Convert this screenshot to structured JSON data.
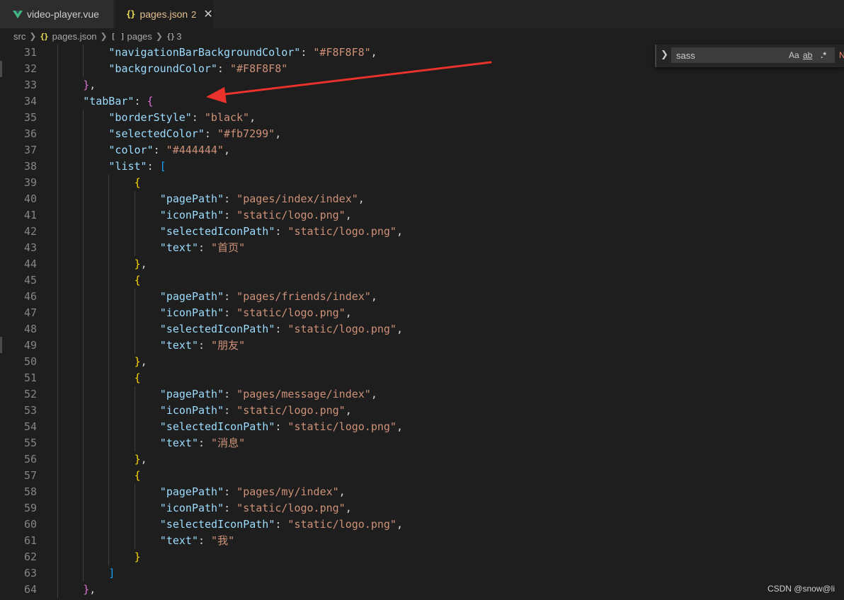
{
  "tabs": [
    {
      "label": "video-player.vue",
      "icon": "vue-icon",
      "active": false
    },
    {
      "label": "pages.json",
      "icon": "braces-icon",
      "badge": "2",
      "active": true
    }
  ],
  "breadcrumb": {
    "items": [
      "src",
      "pages.json",
      "pages",
      "3"
    ]
  },
  "find": {
    "value": "sass",
    "options": [
      "Aa",
      "ab",
      ".*"
    ],
    "result": "N"
  },
  "editor": {
    "lines": [
      {
        "n": "31",
        "indent": 2,
        "tokens": [
          {
            "t": "\"navigationBarBackgroundColor\"",
            "c": "k"
          },
          {
            "t": ": ",
            "c": "p"
          },
          {
            "t": "\"#F8F8F8\"",
            "c": "s"
          },
          {
            "t": ",",
            "c": "p"
          }
        ]
      },
      {
        "n": "32",
        "indent": 2,
        "tokens": [
          {
            "t": "\"backgroundColor\"",
            "c": "k"
          },
          {
            "t": ": ",
            "c": "p"
          },
          {
            "t": "\"#F8F8F8\"",
            "c": "s"
          }
        ]
      },
      {
        "n": "33",
        "indent": 1,
        "tokens": [
          {
            "t": "}",
            "c": "b2"
          },
          {
            "t": ",",
            "c": "p"
          }
        ]
      },
      {
        "n": "34",
        "indent": 1,
        "tokens": [
          {
            "t": "\"tabBar\"",
            "c": "k"
          },
          {
            "t": ": ",
            "c": "p"
          },
          {
            "t": "{",
            "c": "b2"
          }
        ]
      },
      {
        "n": "35",
        "indent": 2,
        "tokens": [
          {
            "t": "\"borderStyle\"",
            "c": "k"
          },
          {
            "t": ": ",
            "c": "p"
          },
          {
            "t": "\"black\"",
            "c": "s"
          },
          {
            "t": ",",
            "c": "p"
          }
        ]
      },
      {
        "n": "36",
        "indent": 2,
        "tokens": [
          {
            "t": "\"selectedColor\"",
            "c": "k"
          },
          {
            "t": ": ",
            "c": "p"
          },
          {
            "t": "\"#fb7299\"",
            "c": "s"
          },
          {
            "t": ",",
            "c": "p"
          }
        ]
      },
      {
        "n": "37",
        "indent": 2,
        "tokens": [
          {
            "t": "\"color\"",
            "c": "k"
          },
          {
            "t": ": ",
            "c": "p"
          },
          {
            "t": "\"#444444\"",
            "c": "s"
          },
          {
            "t": ",",
            "c": "p"
          }
        ]
      },
      {
        "n": "38",
        "indent": 2,
        "tokens": [
          {
            "t": "\"list\"",
            "c": "k"
          },
          {
            "t": ": ",
            "c": "p"
          },
          {
            "t": "[",
            "c": "b3"
          }
        ]
      },
      {
        "n": "39",
        "indent": 3,
        "tokens": [
          {
            "t": "{",
            "c": "b1"
          }
        ]
      },
      {
        "n": "40",
        "indent": 4,
        "tokens": [
          {
            "t": "\"pagePath\"",
            "c": "k"
          },
          {
            "t": ": ",
            "c": "p"
          },
          {
            "t": "\"pages/index/index\"",
            "c": "s"
          },
          {
            "t": ",",
            "c": "p"
          }
        ]
      },
      {
        "n": "41",
        "indent": 4,
        "tokens": [
          {
            "t": "\"iconPath\"",
            "c": "k"
          },
          {
            "t": ": ",
            "c": "p"
          },
          {
            "t": "\"static/logo.png\"",
            "c": "s"
          },
          {
            "t": ",",
            "c": "p"
          }
        ]
      },
      {
        "n": "42",
        "indent": 4,
        "tokens": [
          {
            "t": "\"selectedIconPath\"",
            "c": "k"
          },
          {
            "t": ": ",
            "c": "p"
          },
          {
            "t": "\"static/logo.png\"",
            "c": "s"
          },
          {
            "t": ",",
            "c": "p"
          }
        ]
      },
      {
        "n": "43",
        "indent": 4,
        "tokens": [
          {
            "t": "\"text\"",
            "c": "k"
          },
          {
            "t": ": ",
            "c": "p"
          },
          {
            "t": "\"首页\"",
            "c": "s"
          }
        ]
      },
      {
        "n": "44",
        "indent": 3,
        "tokens": [
          {
            "t": "}",
            "c": "b1"
          },
          {
            "t": ",",
            "c": "p"
          }
        ]
      },
      {
        "n": "45",
        "indent": 3,
        "tokens": [
          {
            "t": "{",
            "c": "b1"
          }
        ]
      },
      {
        "n": "46",
        "indent": 4,
        "tokens": [
          {
            "t": "\"pagePath\"",
            "c": "k"
          },
          {
            "t": ": ",
            "c": "p"
          },
          {
            "t": "\"pages/friends/index\"",
            "c": "s"
          },
          {
            "t": ",",
            "c": "p"
          }
        ]
      },
      {
        "n": "47",
        "indent": 4,
        "tokens": [
          {
            "t": "\"iconPath\"",
            "c": "k"
          },
          {
            "t": ": ",
            "c": "p"
          },
          {
            "t": "\"static/logo.png\"",
            "c": "s"
          },
          {
            "t": ",",
            "c": "p"
          }
        ]
      },
      {
        "n": "48",
        "indent": 4,
        "tokens": [
          {
            "t": "\"selectedIconPath\"",
            "c": "k"
          },
          {
            "t": ": ",
            "c": "p"
          },
          {
            "t": "\"static/logo.png\"",
            "c": "s"
          },
          {
            "t": ",",
            "c": "p"
          }
        ]
      },
      {
        "n": "49",
        "indent": 4,
        "tokens": [
          {
            "t": "\"text\"",
            "c": "k"
          },
          {
            "t": ": ",
            "c": "p"
          },
          {
            "t": "\"朋友\"",
            "c": "s"
          }
        ]
      },
      {
        "n": "50",
        "indent": 3,
        "tokens": [
          {
            "t": "}",
            "c": "b1"
          },
          {
            "t": ",",
            "c": "p"
          }
        ]
      },
      {
        "n": "51",
        "indent": 3,
        "tokens": [
          {
            "t": "{",
            "c": "b1"
          }
        ]
      },
      {
        "n": "52",
        "indent": 4,
        "tokens": [
          {
            "t": "\"pagePath\"",
            "c": "k"
          },
          {
            "t": ": ",
            "c": "p"
          },
          {
            "t": "\"pages/message/index\"",
            "c": "s"
          },
          {
            "t": ",",
            "c": "p"
          }
        ]
      },
      {
        "n": "53",
        "indent": 4,
        "tokens": [
          {
            "t": "\"iconPath\"",
            "c": "k"
          },
          {
            "t": ": ",
            "c": "p"
          },
          {
            "t": "\"static/logo.png\"",
            "c": "s"
          },
          {
            "t": ",",
            "c": "p"
          }
        ]
      },
      {
        "n": "54",
        "indent": 4,
        "tokens": [
          {
            "t": "\"selectedIconPath\"",
            "c": "k"
          },
          {
            "t": ": ",
            "c": "p"
          },
          {
            "t": "\"static/logo.png\"",
            "c": "s"
          },
          {
            "t": ",",
            "c": "p"
          }
        ]
      },
      {
        "n": "55",
        "indent": 4,
        "tokens": [
          {
            "t": "\"text\"",
            "c": "k"
          },
          {
            "t": ": ",
            "c": "p"
          },
          {
            "t": "\"消息\"",
            "c": "s"
          }
        ]
      },
      {
        "n": "56",
        "indent": 3,
        "tokens": [
          {
            "t": "}",
            "c": "b1"
          },
          {
            "t": ",",
            "c": "p"
          }
        ]
      },
      {
        "n": "57",
        "indent": 3,
        "tokens": [
          {
            "t": "{",
            "c": "b1"
          }
        ]
      },
      {
        "n": "58",
        "indent": 4,
        "tokens": [
          {
            "t": "\"pagePath\"",
            "c": "k"
          },
          {
            "t": ": ",
            "c": "p"
          },
          {
            "t": "\"pages/my/index\"",
            "c": "s"
          },
          {
            "t": ",",
            "c": "p"
          }
        ]
      },
      {
        "n": "59",
        "indent": 4,
        "tokens": [
          {
            "t": "\"iconPath\"",
            "c": "k"
          },
          {
            "t": ": ",
            "c": "p"
          },
          {
            "t": "\"static/logo.png\"",
            "c": "s"
          },
          {
            "t": ",",
            "c": "p"
          }
        ]
      },
      {
        "n": "60",
        "indent": 4,
        "tokens": [
          {
            "t": "\"selectedIconPath\"",
            "c": "k"
          },
          {
            "t": ": ",
            "c": "p"
          },
          {
            "t": "\"static/logo.png\"",
            "c": "s"
          },
          {
            "t": ",",
            "c": "p"
          }
        ]
      },
      {
        "n": "61",
        "indent": 4,
        "tokens": [
          {
            "t": "\"text\"",
            "c": "k"
          },
          {
            "t": ": ",
            "c": "p"
          },
          {
            "t": "\"我\"",
            "c": "s"
          }
        ]
      },
      {
        "n": "62",
        "indent": 3,
        "tokens": [
          {
            "t": "}",
            "c": "b1"
          }
        ]
      },
      {
        "n": "63",
        "indent": 2,
        "tokens": [
          {
            "t": "]",
            "c": "b3"
          }
        ]
      },
      {
        "n": "64",
        "indent": 1,
        "tokens": [
          {
            "t": "}",
            "c": "b2"
          },
          {
            "t": ",",
            "c": "p"
          }
        ]
      }
    ]
  },
  "watermark": "CSDN @snow@li",
  "colors": {
    "editor_bg": "#1e1e1e",
    "key": "#9cdcfe",
    "string": "#ce9178",
    "annotation_arrow": "#e8322b",
    "modified_tab": "#e2c08d"
  }
}
